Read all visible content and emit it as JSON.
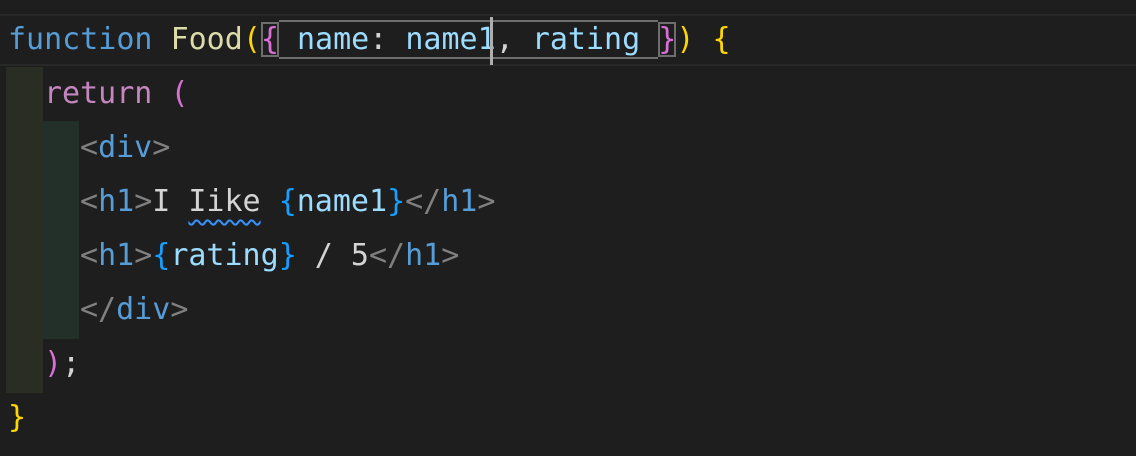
{
  "code": {
    "line1": {
      "kw_function": "function",
      "fn_name": "Food",
      "paren_open": "(",
      "brace_open": "{",
      "prop_name": "name",
      "colon": ":",
      "alias": "name1",
      "comma": ",",
      "prop_rating": "rating",
      "brace_close": "}",
      "paren_close": ")",
      "body_open": "{"
    },
    "line2": {
      "kw_return": "return",
      "paren_open": "("
    },
    "line3": {
      "lt": "<",
      "tag": "div",
      "gt": ">"
    },
    "line4": {
      "lt": "<",
      "tag_open": "h1",
      "gt": ">",
      "text_i": "I",
      "text_like": "Iike",
      "brace_open": "{",
      "var": "name1",
      "brace_close": "}",
      "close_lt": "</",
      "tag_close": "h1",
      "close_gt": ">"
    },
    "line5": {
      "lt": "<",
      "tag_open": "h1",
      "gt": ">",
      "brace_open": "{",
      "var": "rating",
      "brace_close": "}",
      "text": " / 5",
      "close_lt": "</",
      "tag_close": "h1",
      "close_gt": ">"
    },
    "line6": {
      "close_lt": "</",
      "tag": "div",
      "gt": ">"
    },
    "line7": {
      "paren_close": ")",
      "semi": ";"
    },
    "line8": {
      "brace_close": "}"
    }
  }
}
